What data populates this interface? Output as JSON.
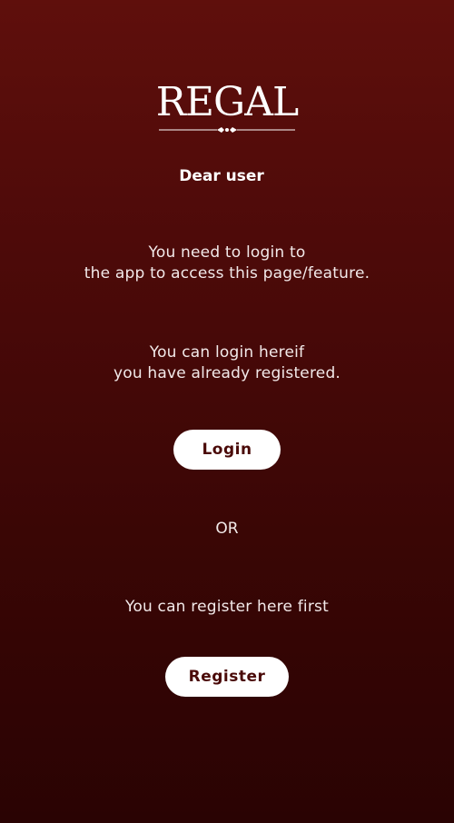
{
  "logo": {
    "text": "REGAL"
  },
  "greeting": "Dear user",
  "login_message": {
    "line1": "You need to login to",
    "line2": "the app to access this page/feature."
  },
  "login_prompt": {
    "line1": "You can login hereif",
    "line2": "you have already registered."
  },
  "login_button_label": "Login",
  "or_label": "OR",
  "register_prompt": "You can register here first",
  "register_button_label": "Register",
  "colors": {
    "background_top": "#5f0f0c",
    "background_bottom": "#2a0303",
    "button_bg": "#ffffff",
    "button_text": "#4a0a08",
    "text": "#f2e9e9"
  }
}
